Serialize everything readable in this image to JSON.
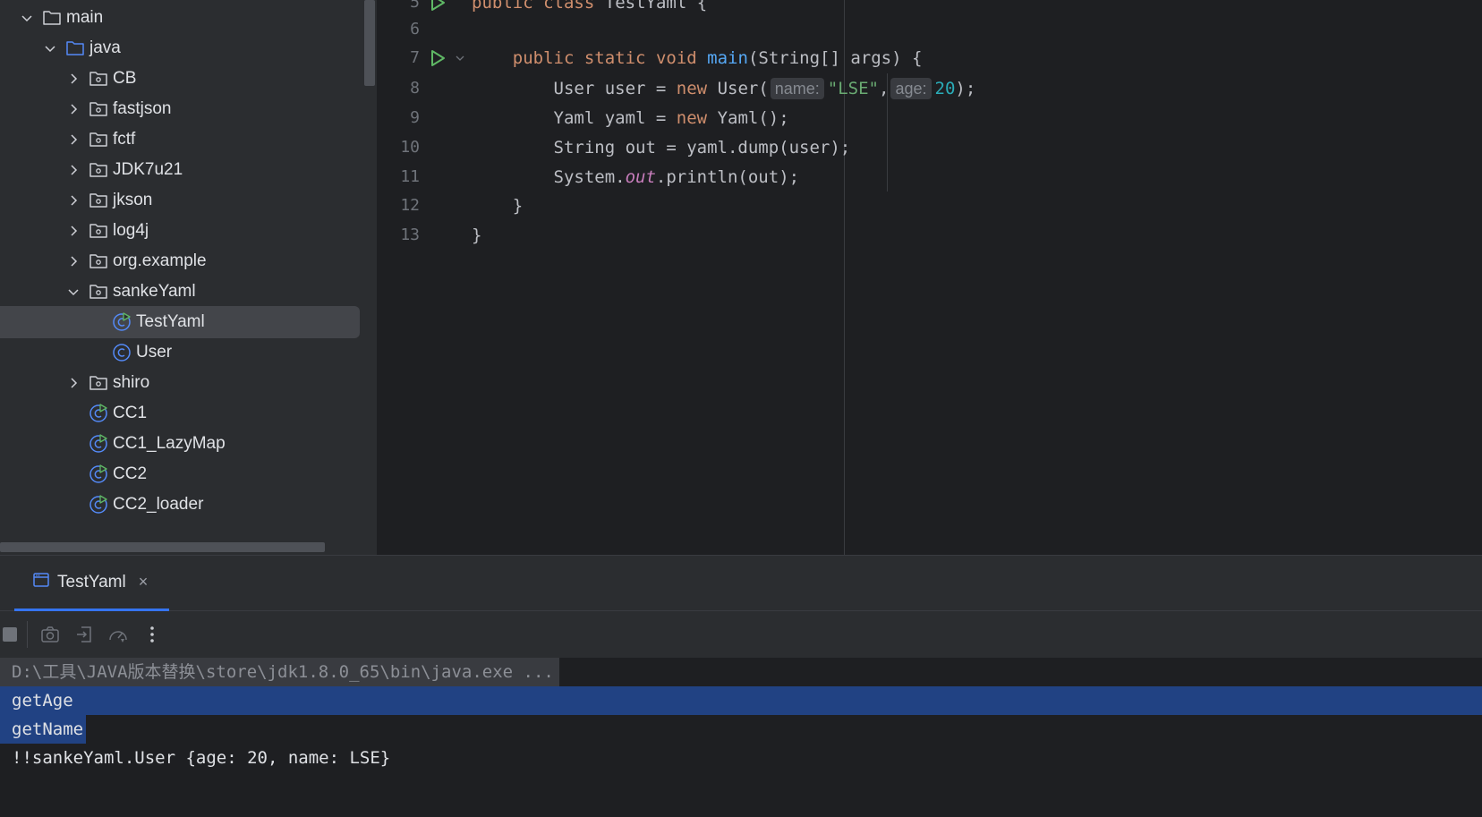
{
  "project_tree": {
    "items": [
      {
        "label": "main",
        "icon": "folder-icon",
        "expanded": true
      },
      {
        "label": "java",
        "icon": "source-folder-icon",
        "expanded": true
      },
      {
        "label": "CB",
        "icon": "package-icon",
        "expanded": false
      },
      {
        "label": "fastjson",
        "icon": "package-icon",
        "expanded": false
      },
      {
        "label": "fctf",
        "icon": "package-icon",
        "expanded": false
      },
      {
        "label": "JDK7u21",
        "icon": "package-icon",
        "expanded": false
      },
      {
        "label": "jkson",
        "icon": "package-icon",
        "expanded": false
      },
      {
        "label": "log4j",
        "icon": "package-icon",
        "expanded": false
      },
      {
        "label": "org.example",
        "icon": "package-icon",
        "expanded": false
      },
      {
        "label": "sankeYaml",
        "icon": "package-icon",
        "expanded": true
      },
      {
        "label": "TestYaml",
        "icon": "runnable-class-icon",
        "selected": true
      },
      {
        "label": "User",
        "icon": "class-icon"
      },
      {
        "label": "shiro",
        "icon": "package-icon",
        "expanded": false
      },
      {
        "label": "CC1",
        "icon": "runnable-class-icon"
      },
      {
        "label": "CC1_LazyMap",
        "icon": "runnable-class-icon"
      },
      {
        "label": "CC2",
        "icon": "runnable-class-icon"
      },
      {
        "label": "CC2_loader",
        "icon": "runnable-class-icon"
      }
    ]
  },
  "editor": {
    "lines": [
      {
        "num": "5",
        "text": "public class TestYaml {"
      },
      {
        "num": "6",
        "text": ""
      },
      {
        "num": "7",
        "text": "public static void main(String[] args) {"
      },
      {
        "num": "8",
        "text": "User user = new User(name: \"LSE\", age: 20);"
      },
      {
        "num": "9",
        "text": "Yaml yaml = new Yaml();"
      },
      {
        "num": "10",
        "text": "String out = yaml.dump(user);"
      },
      {
        "num": "11",
        "text": "System.out.println(out);"
      },
      {
        "num": "12",
        "text": "}"
      },
      {
        "num": "13",
        "text": "}"
      }
    ],
    "tokens": {
      "l5_public": "public",
      "l5_class": "class",
      "l5_name": "TestYaml {",
      "l7_public": "public",
      "l7_static": "static",
      "l7_void": "void",
      "l7_main": "main",
      "l7_rest": "(String[] args) {",
      "l8_a": "User user = ",
      "l8_new": "new",
      "l8_b": " User(",
      "l8_hint_name": "name:",
      "l8_str": "\"LSE\"",
      "l8_comma": ",",
      "l8_hint_age": "age:",
      "l8_num": "20",
      "l8_end": ");",
      "l9_a": "Yaml yaml = ",
      "l9_new": "new",
      "l9_b": " Yaml();",
      "l10": "String out = yaml.dump(user);",
      "l11_a": "System.",
      "l11_out": "out",
      "l11_b": ".println(out);",
      "l12": "}",
      "l13": "}"
    }
  },
  "run_panel": {
    "tab_label": "TestYaml",
    "tab_close": "×",
    "console": [
      "D:\\工具\\JAVA版本替换\\store\\jdk1.8.0_65\\bin\\java.exe ...",
      "getAge",
      "getName",
      "!!sankeYaml.User {age: 20, name: LSE}"
    ]
  },
  "colors": {
    "keyword": "#cf8e6d",
    "function": "#56a8f5",
    "string": "#6aab73",
    "number": "#2aacb8",
    "static_field": "#c77dbb",
    "selection": "#214283",
    "accent": "#3574f0"
  }
}
